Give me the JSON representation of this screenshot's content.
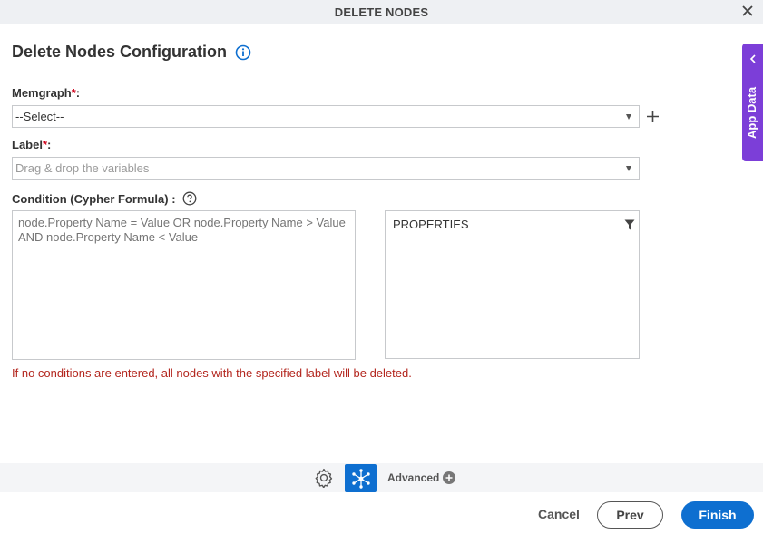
{
  "window": {
    "title": "DELETE NODES"
  },
  "heading": {
    "title": "Delete Nodes Configuration"
  },
  "memgraph": {
    "label": "Memgraph",
    "required_mark": "*",
    "colon": ":",
    "value": "--Select--"
  },
  "label_field": {
    "label": "Label",
    "required_mark": "*",
    "colon": ":",
    "placeholder": "Drag & drop the variables"
  },
  "condition": {
    "label": "Condition (Cypher Formula) :",
    "placeholder": "node.Property Name = Value OR node.Property Name > Value AND node.Property Name < Value"
  },
  "properties": {
    "header": "PROPERTIES"
  },
  "warning": "If no conditions are entered, all nodes with the specified label will be deleted.",
  "toolbar": {
    "advanced_label": "Advanced"
  },
  "buttons": {
    "cancel": "Cancel",
    "prev": "Prev",
    "finish": "Finish"
  },
  "side_panel": {
    "label": "App Data"
  },
  "colors": {
    "accent": "#0e6fd0",
    "side_panel": "#7c3ed8",
    "required": "#d0021b",
    "warning": "#b3261e"
  },
  "icons": [
    "close-icon",
    "info-icon",
    "plus-icon",
    "help-icon",
    "filter-icon",
    "gear-icon",
    "node-network-icon",
    "add-circle-icon",
    "chevron-left-icon"
  ]
}
